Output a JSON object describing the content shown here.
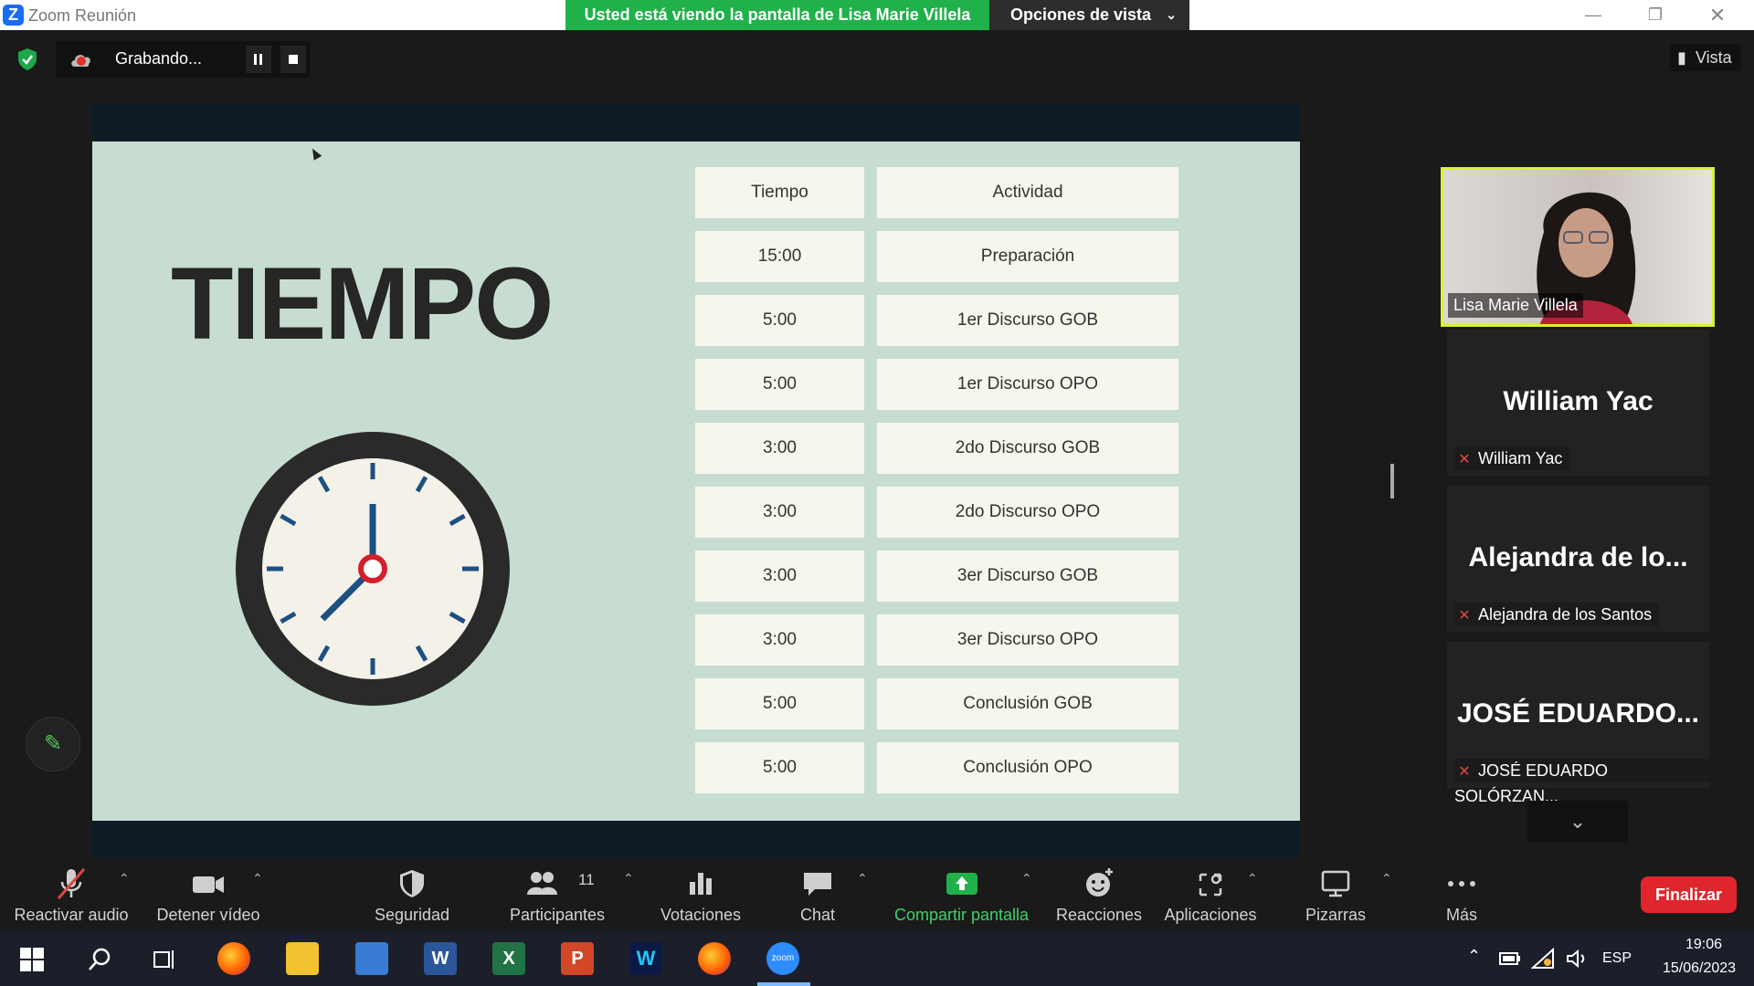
{
  "window": {
    "title": "Zoom Reunión",
    "share_banner": "Usted está viendo la pantalla de Lisa Marie Villela",
    "view_options": "Opciones de vista"
  },
  "recording": {
    "label": "Grabando..."
  },
  "view_button": "Vista",
  "slide": {
    "title": "TIEMPO",
    "table": {
      "headers": [
        "Tiempo",
        "Actividad"
      ],
      "rows": [
        [
          "15:00",
          "Preparación"
        ],
        [
          "5:00",
          "1er Discurso GOB"
        ],
        [
          "5:00",
          "1er Discurso OPO"
        ],
        [
          "3:00",
          "2do Discurso GOB"
        ],
        [
          "3:00",
          "2do Discurso OPO"
        ],
        [
          "3:00",
          "3er Discurso GOB"
        ],
        [
          "3:00",
          "3er Discurso OPO"
        ],
        [
          "5:00",
          "Conclusión GOB"
        ],
        [
          "5:00",
          "Conclusión OPO"
        ]
      ]
    }
  },
  "gallery": {
    "active_speaker": "Lisa Marie Villela",
    "tiles": [
      {
        "big": "William Yac",
        "name": "William Yac"
      },
      {
        "big": "Alejandra de lo...",
        "name": "Alejandra de los Santos"
      },
      {
        "big": "JOSÉ  EDUARDO...",
        "name": "JOSÉ EDUARDO SOLÓRZAN..."
      }
    ]
  },
  "toolbar": {
    "audio": "Reactivar audio",
    "video": "Detener vídeo",
    "security": "Seguridad",
    "participants": "Participantes",
    "participants_count": "11",
    "polls": "Votaciones",
    "chat": "Chat",
    "share": "Compartir pantalla",
    "reactions": "Reacciones",
    "apps": "Aplicaciones",
    "whiteboards": "Pizarras",
    "more": "Más",
    "end": "Finalizar"
  },
  "taskbar": {
    "language": "ESP",
    "time": "19:06",
    "date": "15/06/2023",
    "zoom_icon_text": "zoom"
  },
  "colors": {
    "share_green": "#21b14b",
    "active_border": "#d7f03a",
    "end_red": "#e0252d",
    "slide_bg": "#c8ddd1"
  }
}
